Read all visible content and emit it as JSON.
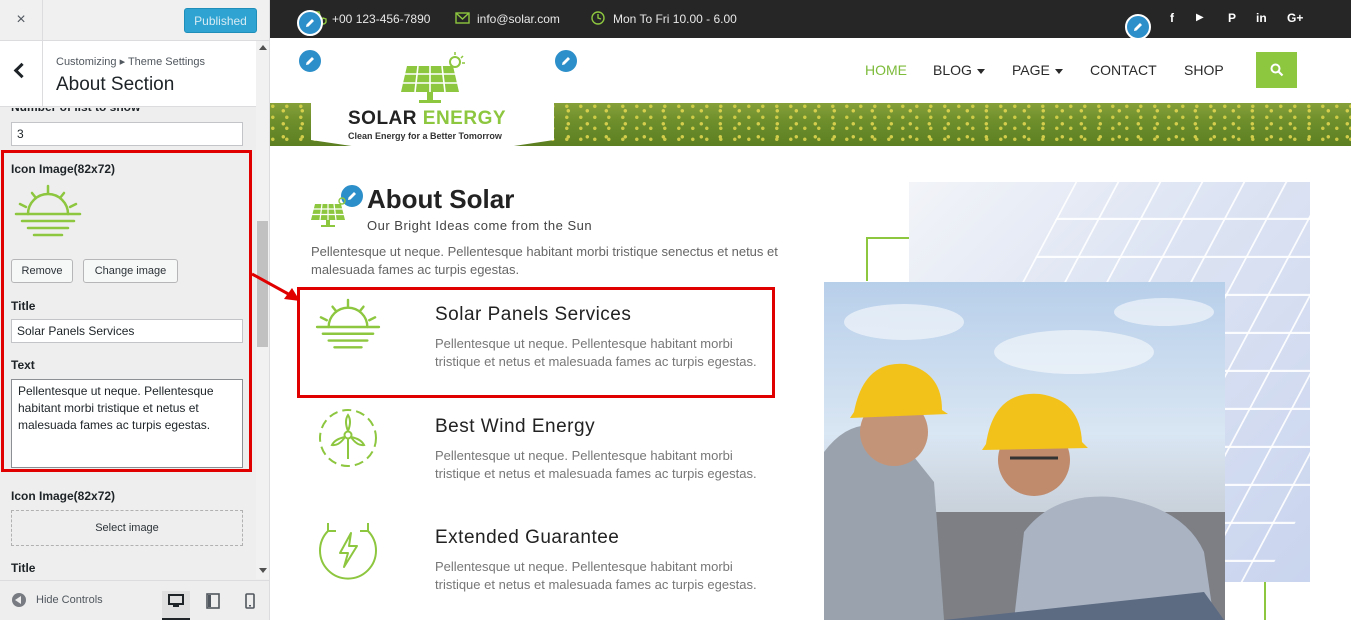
{
  "customizer": {
    "close_icon": "×",
    "publish_label": "Published",
    "breadcrumb": "Customizing ▸ Theme Settings",
    "section_title": "About Section",
    "number_label": "Number of list to show",
    "number_value": "3",
    "item1": {
      "icon_label": "Icon Image(82x72)",
      "remove_label": "Remove",
      "change_label": "Change image",
      "title_label": "Title",
      "title_value": "Solar Panels Services",
      "text_label": "Text",
      "text_value": "Pellentesque ut neque. Pellentesque habitant morbi tristique et netus et malesuada fames ac turpis egestas."
    },
    "item2": {
      "icon_label": "Icon Image(82x72)",
      "select_label": "Select image",
      "title_label": "Title"
    },
    "footer": {
      "hide_label": "Hide Controls"
    },
    "highlight_color": "#e00000",
    "publish_color": "#2fa4d3"
  },
  "site": {
    "topbar": {
      "phone": "+00 123-456-7890",
      "email": "info@solar.com",
      "hours": "Mon To Fri 10.00 - 6.00",
      "social_icons": [
        "facebook-icon",
        "youtube-icon",
        "pinterest-icon",
        "linkedin-icon",
        "google-plus-icon"
      ],
      "social_glyphs": [
        "f",
        "▶",
        "P",
        "in",
        "G+"
      ]
    },
    "logo": {
      "name_main": "SOLAR",
      "name_accent": "ENERGY",
      "tagline": "Clean Energy for a Better Tomorrow"
    },
    "nav": {
      "home": "HOME",
      "blog": "BLOG",
      "page": "PAGE",
      "contact": "CONTACT",
      "shop": "SHOP"
    },
    "accent_color": "#8dc63f",
    "about": {
      "title": "About Solar",
      "subtitle": "Our Bright Ideas come from the Sun",
      "description": "Pellentesque ut neque. Pellentesque habitant morbi tristique senectus et netus et malesuada fames ac turpis egestas.",
      "features": [
        {
          "icon": "sunrise-icon",
          "title": "Solar Panels Services",
          "text": "Pellentesque ut neque. Pellentesque habitant morbi tristique et netus et malesuada fames ac turpis egestas."
        },
        {
          "icon": "wind-turbine-icon",
          "title": "Best Wind Energy",
          "text": "Pellentesque ut neque. Pellentesque habitant morbi tristique et netus et malesuada fames ac turpis egestas."
        },
        {
          "icon": "energy-recycle-icon",
          "title": "Extended Guarantee",
          "text": "Pellentesque ut neque. Pellentesque habitant morbi tristique et netus et malesuada fames ac turpis egestas."
        }
      ]
    }
  }
}
